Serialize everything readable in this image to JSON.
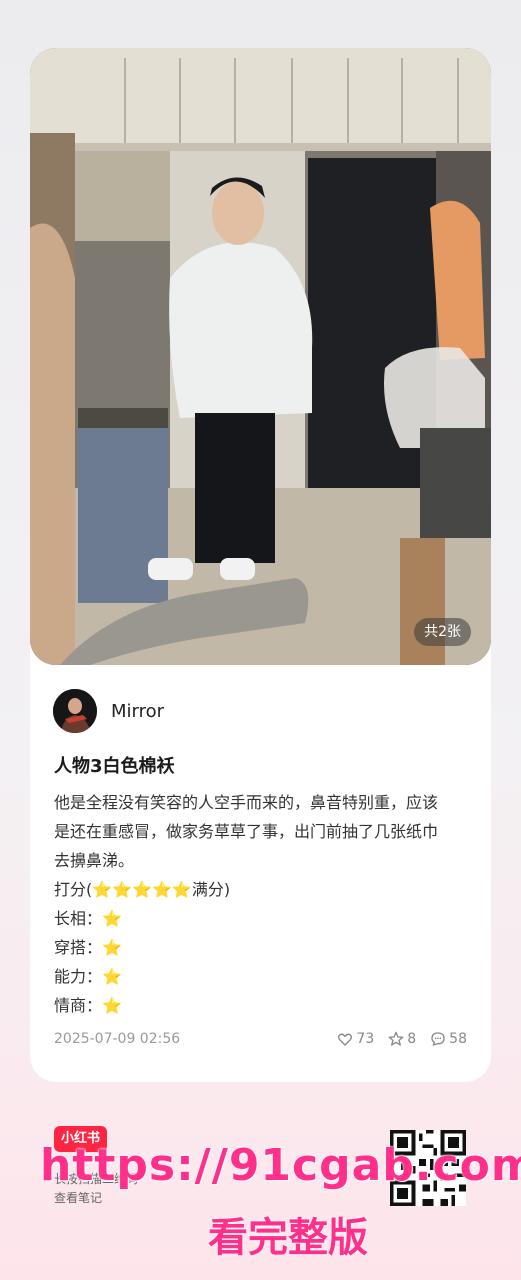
{
  "post": {
    "image_count": "共2张",
    "author": "Mirror",
    "title": "人物3白色棉袄",
    "body_lines": [
      "他是全程没有笑容的人空手而来的，鼻音特别重，应该",
      "是还在重感冒，做家务草草了事，出门前抽了几张纸巾",
      "去擤鼻涕。",
      "打分(⭐⭐⭐⭐⭐满分)",
      "长相：⭐",
      "穿搭：⭐",
      "能力：⭐",
      "情商：⭐"
    ],
    "date": "2025-07-09 02:56",
    "likes": "73",
    "favorites": "8",
    "comments": "58"
  },
  "footer": {
    "logo": "小红书",
    "hint_line1": "长按扫描二维码",
    "hint_line2": "查看笔记"
  },
  "watermark": {
    "url": "https://91cgab.com",
    "cta": "看完整版"
  },
  "colors": {
    "brand": "#ff2442",
    "watermark": "#ff2f8a"
  },
  "icons": [
    "heart-icon",
    "star-icon",
    "comment-icon",
    "qr-code"
  ]
}
